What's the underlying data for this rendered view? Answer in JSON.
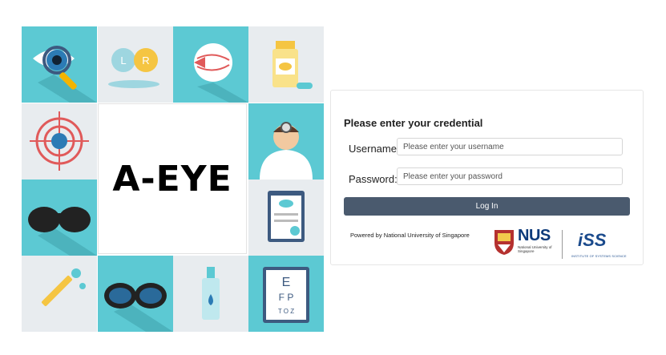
{
  "banner": {
    "title": "A-EYE",
    "tiles": [
      {
        "icon": "magnifier-eye-icon"
      },
      {
        "icon": "contact-lens-case-icon",
        "left_label": "L",
        "right_label": "R"
      },
      {
        "icon": "eyeball-anatomy-icon"
      },
      {
        "icon": "pill-bottle-icon"
      },
      {
        "icon": "target-eye-icon"
      },
      {
        "icon": "doctor-icon"
      },
      {
        "icon": "pinhole-glasses-icon"
      },
      {
        "icon": "clipboard-icon"
      },
      {
        "icon": "eye-dropper-icon"
      },
      {
        "icon": "sunglasses-icon"
      },
      {
        "icon": "eye-drops-bottle-icon"
      },
      {
        "icon": "eye-chart-icon",
        "chart_rows": [
          "E",
          "F P",
          "T O Z"
        ]
      }
    ],
    "colors": {
      "cyan": "#5cc9d3",
      "light": "#e8ecef"
    }
  },
  "login": {
    "heading": "Please enter your credential",
    "username_label": "Username:",
    "username_placeholder": "Please enter your username",
    "password_label": "Password:",
    "password_placeholder": "Please enter your password",
    "login_button": "Log In",
    "powered_by": "Powered by National University of Singapore",
    "button_color": "#4a5a6e"
  },
  "logos": {
    "nus": {
      "name": "NUS",
      "subtitle": "National University of Singapore"
    },
    "iss": {
      "name": "iSS",
      "subtitle": "INSTITUTE OF SYSTEMS SCIENCE"
    }
  }
}
